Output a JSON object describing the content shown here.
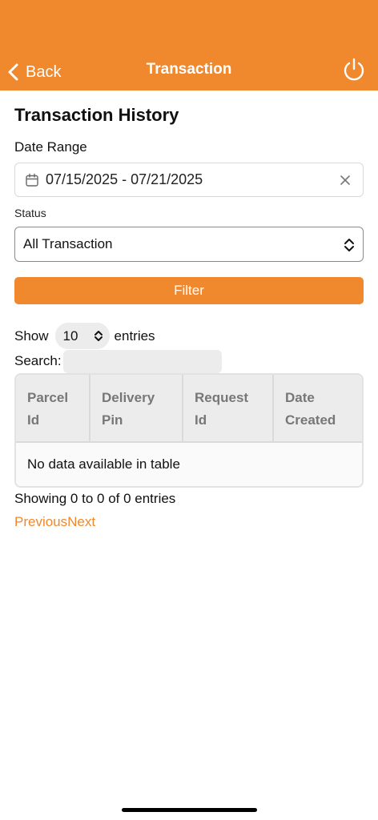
{
  "header": {
    "back_label": "Back",
    "title": "Transaction",
    "icons": {
      "back": "chevron-left-icon",
      "power": "power-icon"
    },
    "color": "#f0882e"
  },
  "main": {
    "page_title": "Transaction History",
    "date_range": {
      "label": "Date Range",
      "value": "07/15/2025 - 07/21/2025"
    },
    "status": {
      "label": "Status",
      "selected": "All Transaction"
    },
    "filter_label": "Filter",
    "length": {
      "prefix": "Show",
      "value": "10",
      "suffix": "entries"
    },
    "search": {
      "label": "Search:",
      "value": ""
    },
    "table": {
      "columns": [
        [
          "Parcel",
          "Id"
        ],
        [
          "Delivery",
          "Pin"
        ],
        [
          "Request",
          "Id"
        ],
        [
          "Date",
          "Created"
        ]
      ],
      "empty_message": "No data available in table"
    },
    "info": "Showing 0 to 0 of 0 entries",
    "pagination": {
      "previous": "Previous",
      "next": "Next"
    }
  }
}
